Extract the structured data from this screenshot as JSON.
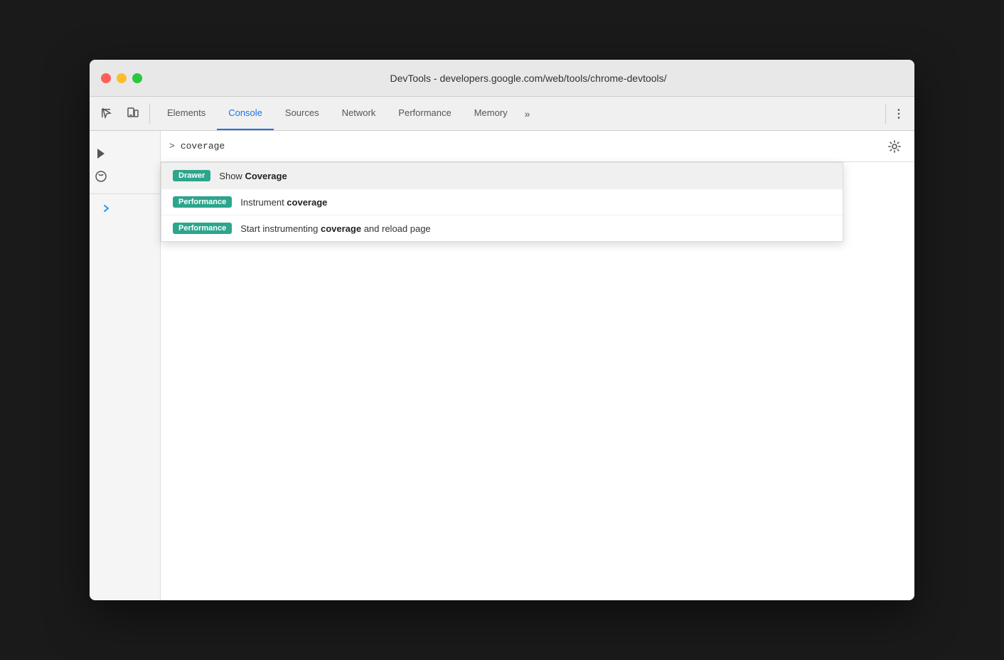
{
  "window": {
    "title": "DevTools - developers.google.com/web/tools/chrome-devtools/",
    "controls": {
      "close": "close",
      "minimize": "minimize",
      "maximize": "maximize"
    }
  },
  "toolbar": {
    "tabs": [
      {
        "id": "elements",
        "label": "Elements",
        "active": false
      },
      {
        "id": "console",
        "label": "Console",
        "active": true
      },
      {
        "id": "sources",
        "label": "Sources",
        "active": false
      },
      {
        "id": "network",
        "label": "Network",
        "active": false
      },
      {
        "id": "performance",
        "label": "Performance",
        "active": false
      },
      {
        "id": "memory",
        "label": "Memory",
        "active": false
      }
    ],
    "overflow_label": "»",
    "more_label": "⋮"
  },
  "console": {
    "prompt": ">",
    "input_value": "coverage"
  },
  "autocomplete": {
    "items": [
      {
        "badge_type": "drawer",
        "badge_label": "Drawer",
        "text_before": "Show ",
        "text_bold": "Coverage",
        "text_after": "",
        "highlighted": true
      },
      {
        "badge_type": "performance",
        "badge_label": "Performance",
        "text_before": "Instrument ",
        "text_bold": "coverage",
        "text_after": "",
        "highlighted": false
      },
      {
        "badge_type": "performance",
        "badge_label": "Performance",
        "text_before": "Start instrumenting ",
        "text_bold": "coverage",
        "text_after": " and reload page",
        "highlighted": false
      }
    ]
  }
}
